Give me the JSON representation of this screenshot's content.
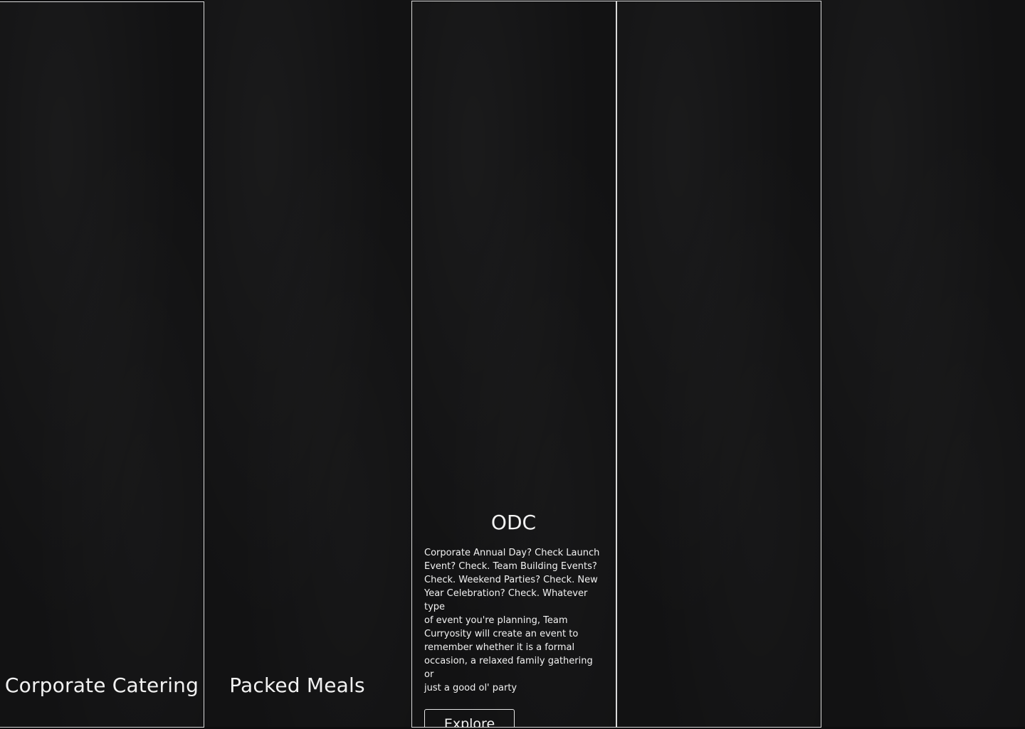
{
  "panels": [
    {
      "title": "Corporate Catering"
    },
    {
      "title": "Packed Meals"
    },
    {
      "title": "ODC",
      "description": " Corporate Annual Day? Check Launch\nEvent? Check. Team Building Events?\nCheck. Weekend Parties? Check. New\nYear Celebration? Check. Whatever type\nof event you're planning, Team\nCurryosity will create an event to\nremember whether it is a formal\noccasion, a relaxed family gathering or\njust a good ol' party",
      "button_label": "Explore"
    },
    {
      "title": ""
    },
    {
      "title": ""
    }
  ],
  "colors": {
    "background": "#121213",
    "border": "#d9d9d9",
    "text": "#f2f2f2"
  }
}
